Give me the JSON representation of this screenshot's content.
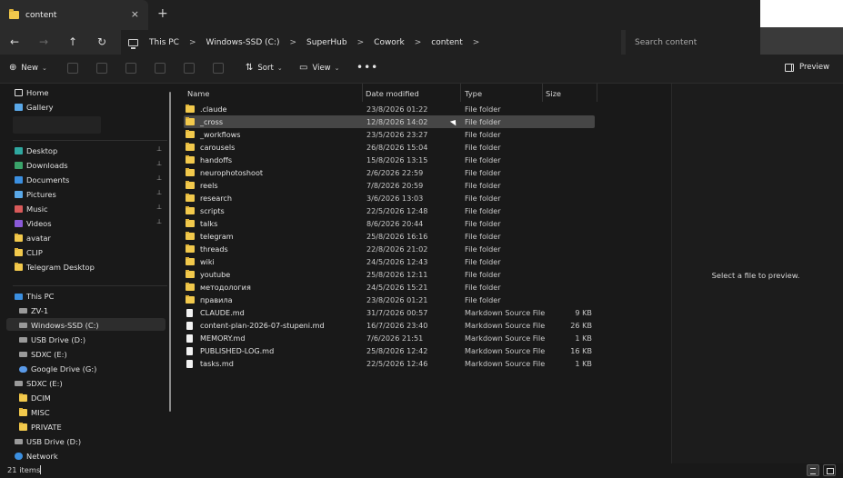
{
  "tab": {
    "title": "content",
    "close": "×",
    "new": "+"
  },
  "nav": {
    "back": "←",
    "forward": "→",
    "up": "↑",
    "refresh": "↻"
  },
  "breadcrumb": [
    "This PC",
    "Windows-SSD (C:)",
    "SuperHub",
    "Cowork",
    "content"
  ],
  "breadcrumb_sep": ">",
  "search": {
    "placeholder": "Search content"
  },
  "toolbar": {
    "new_label": "New",
    "sort_label": "Sort",
    "view_label": "View",
    "more": "•••",
    "preview_label": "Preview"
  },
  "sidebar": {
    "top": [
      {
        "label": "Home",
        "icon": "home"
      },
      {
        "label": "Gallery",
        "icon": "sky"
      }
    ],
    "quick": [
      {
        "label": "Desktop",
        "icon": "teal",
        "pinned": true
      },
      {
        "label": "Downloads",
        "icon": "green",
        "pinned": true
      },
      {
        "label": "Documents",
        "icon": "blue",
        "pinned": true
      },
      {
        "label": "Pictures",
        "icon": "sky",
        "pinned": true
      },
      {
        "label": "Music",
        "icon": "red",
        "pinned": true
      },
      {
        "label": "Videos",
        "icon": "purple",
        "pinned": true
      },
      {
        "label": "avatar",
        "icon": "folder",
        "pinned": false
      },
      {
        "label": "CLIP",
        "icon": "folder",
        "pinned": false
      },
      {
        "label": "Telegram Desktop",
        "icon": "folder",
        "pinned": false
      }
    ],
    "tree": [
      {
        "label": "This PC",
        "icon": "monitor",
        "indent": 0
      },
      {
        "label": "ZV-1",
        "icon": "drive",
        "indent": 1
      },
      {
        "label": "Windows-SSD (C:)",
        "icon": "drive",
        "indent": 1,
        "selected": true
      },
      {
        "label": "USB Drive (D:)",
        "icon": "drive",
        "indent": 1
      },
      {
        "label": "SDXC (E:)",
        "icon": "drive",
        "indent": 1
      },
      {
        "label": "Google Drive (G:)",
        "icon": "cloud",
        "indent": 1
      },
      {
        "label": "SDXC (E:)",
        "icon": "drive",
        "indent": 0
      },
      {
        "label": "DCIM",
        "icon": "folder",
        "indent": 1
      },
      {
        "label": "MISC",
        "icon": "folder",
        "indent": 1
      },
      {
        "label": "PRIVATE",
        "icon": "folder",
        "indent": 1
      },
      {
        "label": "USB Drive (D:)",
        "icon": "drive",
        "indent": 0
      },
      {
        "label": "Network",
        "icon": "net",
        "indent": 0
      }
    ],
    "pin_glyph": "📌"
  },
  "columns": {
    "name": "Name",
    "date": "Date modified",
    "type": "Type",
    "size": "Size"
  },
  "files": [
    {
      "name": ".claude",
      "date": "23/8/2026 01:22",
      "type": "File folder",
      "size": "",
      "kind": "folder"
    },
    {
      "name": "_cross",
      "date": "12/8/2026 14:02",
      "type": "File folder",
      "size": "",
      "kind": "folder",
      "selected": true
    },
    {
      "name": "_workflows",
      "date": "23/5/2026 23:27",
      "type": "File folder",
      "size": "",
      "kind": "folder"
    },
    {
      "name": "carousels",
      "date": "26/8/2026 15:04",
      "type": "File folder",
      "size": "",
      "kind": "folder"
    },
    {
      "name": "handoffs",
      "date": "15/8/2026 13:15",
      "type": "File folder",
      "size": "",
      "kind": "folder"
    },
    {
      "name": "neurophotoshoot",
      "date": "2/6/2026 22:59",
      "type": "File folder",
      "size": "",
      "kind": "folder"
    },
    {
      "name": "reels",
      "date": "7/8/2026 20:59",
      "type": "File folder",
      "size": "",
      "kind": "folder"
    },
    {
      "name": "research",
      "date": "3/6/2026 13:03",
      "type": "File folder",
      "size": "",
      "kind": "folder"
    },
    {
      "name": "scripts",
      "date": "22/5/2026 12:48",
      "type": "File folder",
      "size": "",
      "kind": "folder"
    },
    {
      "name": "talks",
      "date": "8/6/2026 20:44",
      "type": "File folder",
      "size": "",
      "kind": "folder"
    },
    {
      "name": "telegram",
      "date": "25/8/2026 16:16",
      "type": "File folder",
      "size": "",
      "kind": "folder"
    },
    {
      "name": "threads",
      "date": "22/8/2026 21:02",
      "type": "File folder",
      "size": "",
      "kind": "folder"
    },
    {
      "name": "wiki",
      "date": "24/5/2026 12:43",
      "type": "File folder",
      "size": "",
      "kind": "folder"
    },
    {
      "name": "youtube",
      "date": "25/8/2026 12:11",
      "type": "File folder",
      "size": "",
      "kind": "folder"
    },
    {
      "name": "методология",
      "date": "24/5/2026 15:21",
      "type": "File folder",
      "size": "",
      "kind": "folder"
    },
    {
      "name": "правила",
      "date": "23/8/2026 01:21",
      "type": "File folder",
      "size": "",
      "kind": "folder"
    },
    {
      "name": "CLAUDE.md",
      "date": "31/7/2026 00:57",
      "type": "Markdown Source File",
      "size": "9 KB",
      "kind": "doc"
    },
    {
      "name": "content-plan-2026-07-stupeni.md",
      "date": "16/7/2026 23:40",
      "type": "Markdown Source File",
      "size": "26 KB",
      "kind": "doc"
    },
    {
      "name": "MEMORY.md",
      "date": "7/6/2026 21:51",
      "type": "Markdown Source File",
      "size": "1 KB",
      "kind": "doc"
    },
    {
      "name": "PUBLISHED-LOG.md",
      "date": "25/8/2026 12:42",
      "type": "Markdown Source File",
      "size": "16 KB",
      "kind": "doc"
    },
    {
      "name": "tasks.md",
      "date": "22/5/2026 12:46",
      "type": "Markdown Source File",
      "size": "1 KB",
      "kind": "doc"
    }
  ],
  "preview": {
    "message": "Select a file to preview."
  },
  "status": {
    "count": "21 items"
  },
  "colors": {
    "accent_folder": "#f2c94c",
    "bg": "#191919",
    "selection": "#464646"
  }
}
